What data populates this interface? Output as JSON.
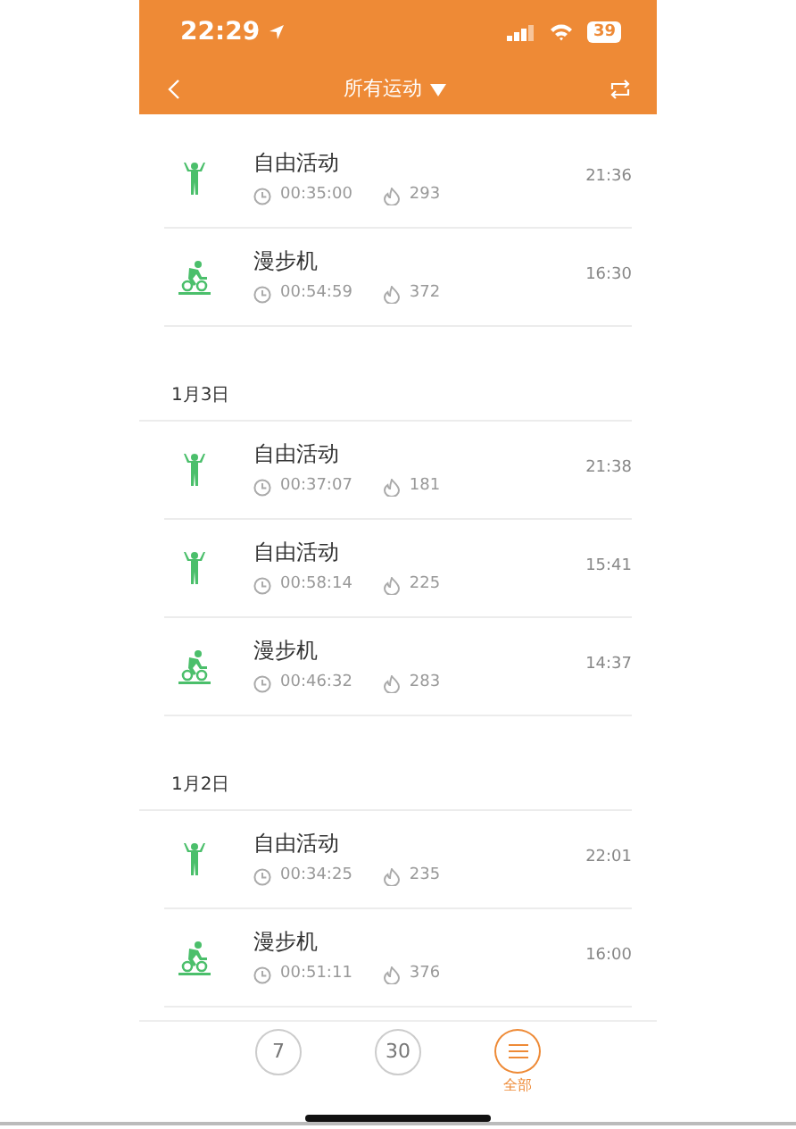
{
  "status_bar": {
    "time": "22:29",
    "battery": "39"
  },
  "nav": {
    "title": "所有运动"
  },
  "groups": [
    {
      "entries": [
        {
          "kind": "free",
          "name": "自由活动",
          "duration": "00:35:00",
          "calories": "293",
          "time": "21:36"
        },
        {
          "kind": "bike",
          "name": "漫步机",
          "duration": "00:54:59",
          "calories": "372",
          "time": "16:30"
        }
      ]
    },
    {
      "date": "1月3日",
      "entries": [
        {
          "kind": "free",
          "name": "自由活动",
          "duration": "00:37:07",
          "calories": "181",
          "time": "21:38"
        },
        {
          "kind": "free",
          "name": "自由活动",
          "duration": "00:58:14",
          "calories": "225",
          "time": "15:41"
        },
        {
          "kind": "bike",
          "name": "漫步机",
          "duration": "00:46:32",
          "calories": "283",
          "time": "14:37"
        }
      ]
    },
    {
      "date": "1月2日",
      "entries": [
        {
          "kind": "free",
          "name": "自由活动",
          "duration": "00:34:25",
          "calories": "235",
          "time": "22:01"
        },
        {
          "kind": "bike",
          "name": "漫步机",
          "duration": "00:51:11",
          "calories": "376",
          "time": "16:00"
        }
      ]
    }
  ],
  "tabs": [
    {
      "kind": "number",
      "text": "7",
      "selected": false
    },
    {
      "kind": "number",
      "text": "30",
      "selected": false
    },
    {
      "kind": "menu",
      "caption": "全部",
      "selected": true
    }
  ]
}
